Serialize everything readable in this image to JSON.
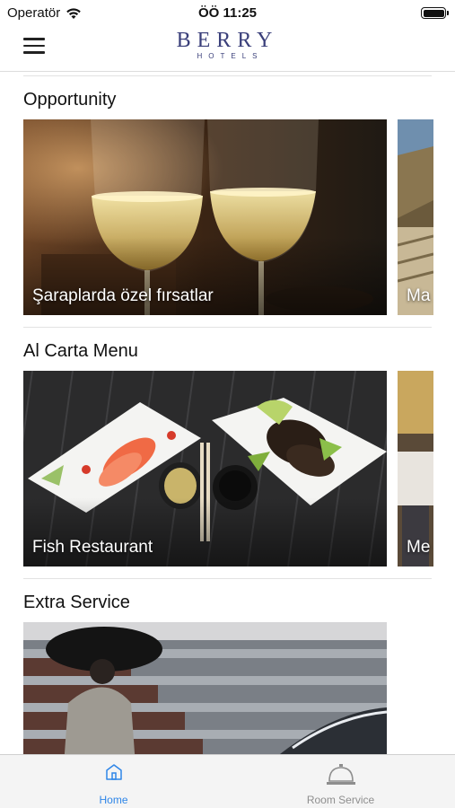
{
  "status_bar": {
    "carrier": "Operatör",
    "time": "ÖÖ 11:25"
  },
  "header": {
    "brand_name": "BERRY",
    "brand_sub": "HOTELS",
    "brand_color": "#3a3f7a"
  },
  "sections": [
    {
      "title": "Opportunity",
      "cards": [
        {
          "label": "Şaraplarda özel fırsatlar",
          "image": "wine-glasses"
        },
        {
          "label": "Ma",
          "image": "outdoor-terrace"
        }
      ]
    },
    {
      "title": "Al Carta Menu",
      "cards": [
        {
          "label": "Fish Restaurant",
          "image": "sashimi-plates"
        },
        {
          "label": "Me",
          "image": "restaurant-interior"
        }
      ]
    },
    {
      "title": "Extra Service",
      "cards": [
        {
          "label": "",
          "image": "hotel-umbrella-arrival"
        }
      ]
    }
  ],
  "tab_bar": {
    "items": [
      {
        "label": "Home",
        "icon": "home-icon",
        "active": true
      },
      {
        "label": "Room Service",
        "icon": "service-bell-icon",
        "active": false
      }
    ],
    "active_color": "#2f86e8",
    "inactive_color": "#8e8e8e"
  }
}
